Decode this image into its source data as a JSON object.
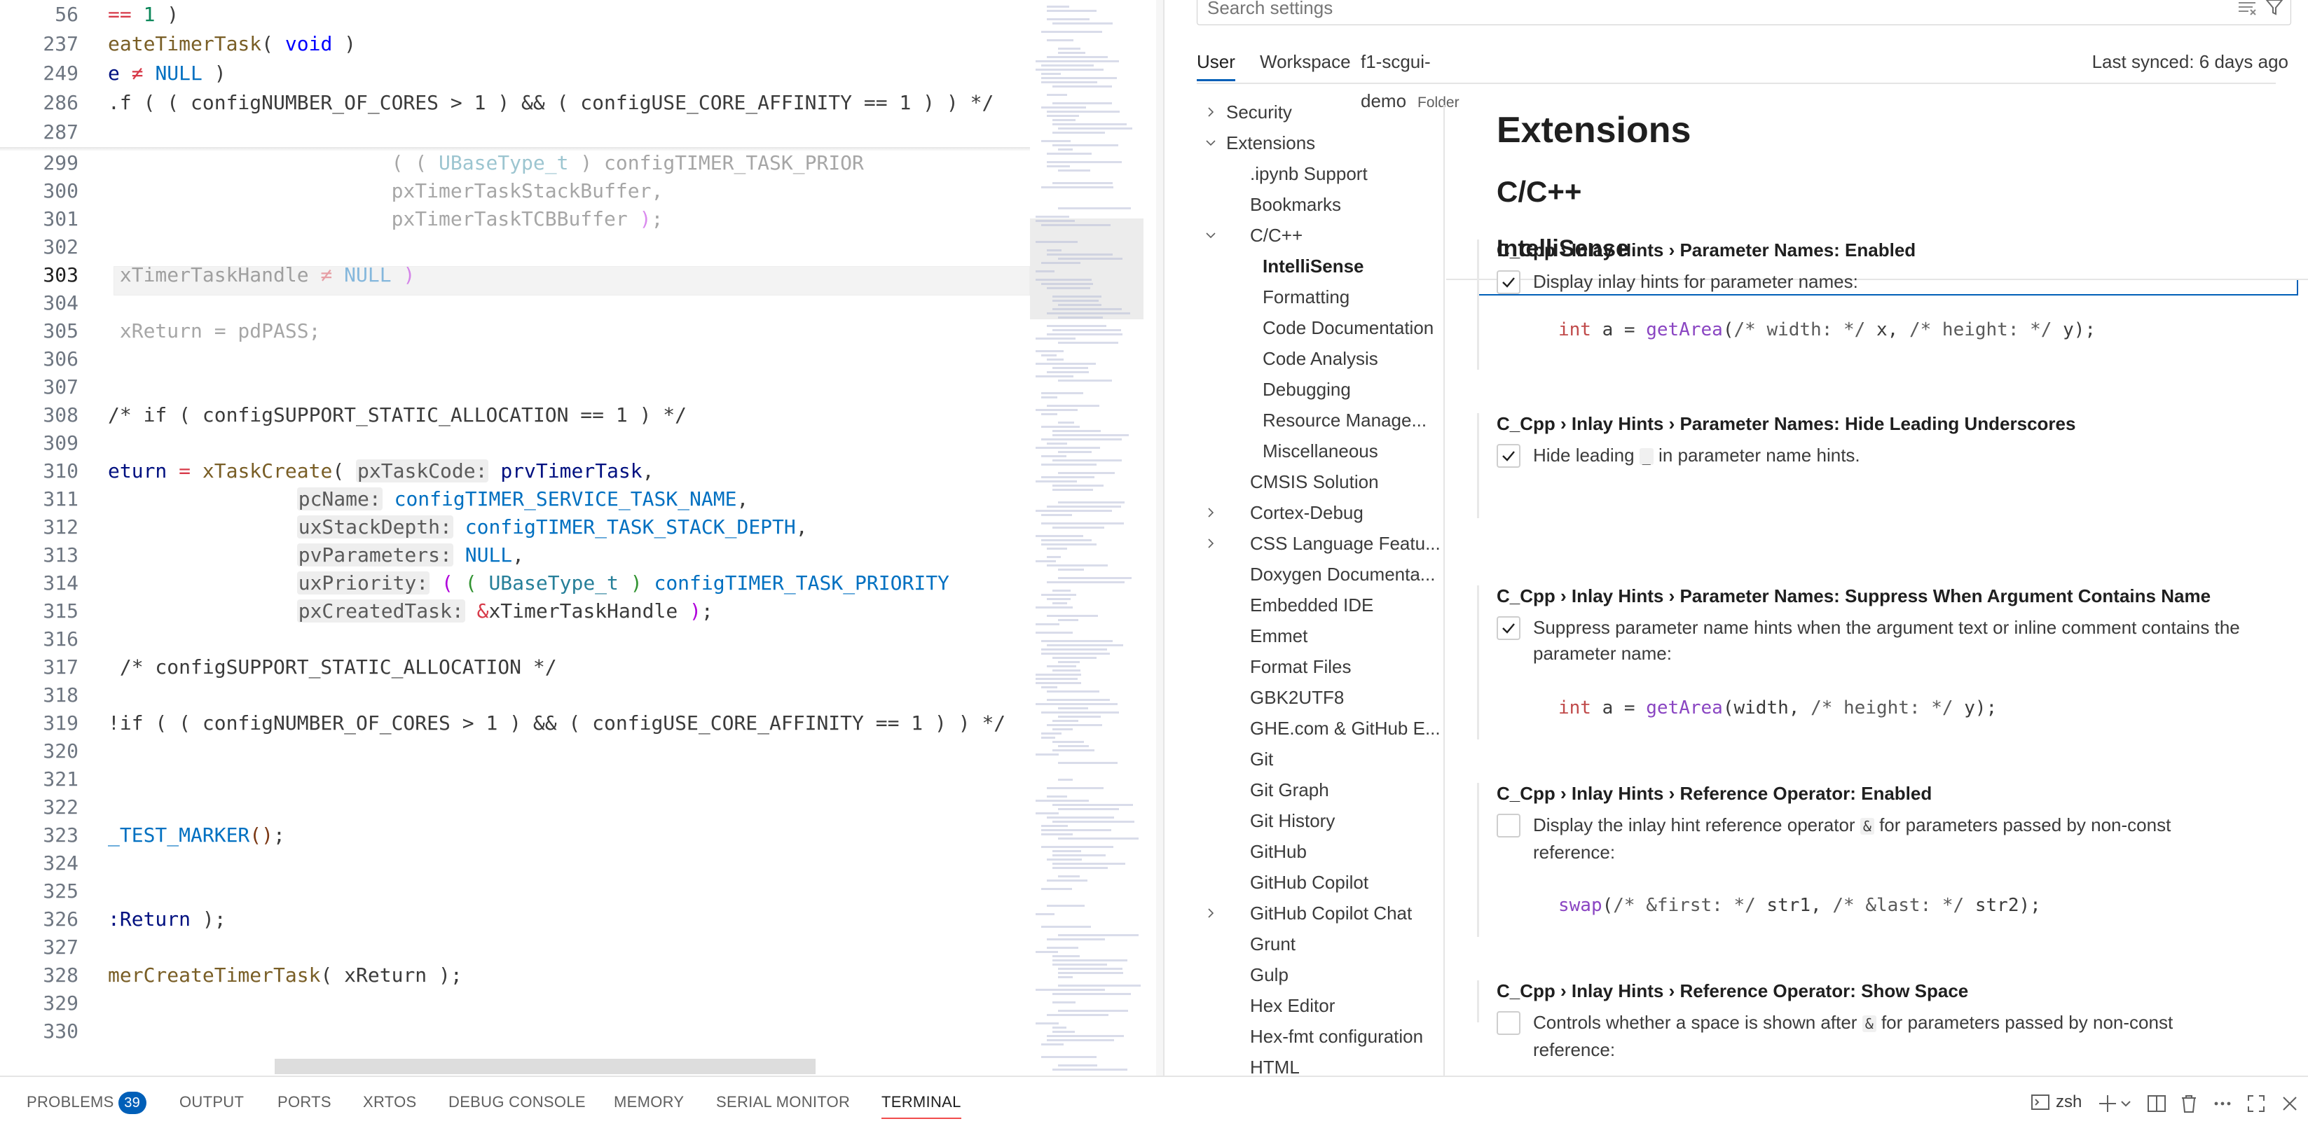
{
  "editor": {
    "lines": [
      {
        "n": "56",
        "sticky": true,
        "html": "<span class='op'>==</span> <span class='nm'>1</span> <span class='br'>)</span>"
      },
      {
        "n": "237",
        "sticky": true,
        "html": "<span class='fn'>eateTimerTask</span>( <span class='k'>void</span> )"
      },
      {
        "n": "249",
        "sticky": true,
        "html": "<span class='vr'>e</span> <span class='op'>&#8800;</span> <span class='mc'>NULL</span> )"
      },
      {
        "n": "286",
        "sticky": true,
        "html": "<span class='cm'>.f ( ( configNUMBER_OF_CORES &gt; 1 ) &amp;&amp; ( configUSE_CORE_AFFINITY &#61;&#61; 1 ) ) */</span>"
      },
      {
        "n": "287",
        "sticky": true,
        "html": ""
      },
      {
        "n": "299",
        "html": "                        <span class='dim'>( ( <span class='ty'>UBaseType_t</span> ) configTIMER_TASK_PRIOR</span>"
      },
      {
        "n": "300",
        "html": "                        <span class='dim'>pxTimerTaskStackBuffer,</span>"
      },
      {
        "n": "301",
        "html": "                        <span class='dim'>pxTimerTaskTCBBuffer <span class='kr'>)</span>;</span>"
      },
      {
        "n": "302",
        "html": ""
      },
      {
        "n": "303",
        "active": true,
        "html": "<span class='dim'> xTimerTaskHandle <span class='op'>&#8800;</span> <span class='mc'>NULL</span> <span class='kr'>)</span></span>"
      },
      {
        "n": "304",
        "html": ""
      },
      {
        "n": "305",
        "html": "<span class='dim'> xReturn = pdPASS;</span>"
      },
      {
        "n": "306",
        "html": ""
      },
      {
        "n": "307",
        "html": ""
      },
      {
        "n": "308",
        "html": "<span class='cm'>/* if ( configSUPPORT_STATIC_ALLOCATION &#61;&#61; 1 ) */</span>"
      },
      {
        "n": "309",
        "html": ""
      },
      {
        "n": "310",
        "html": "<span class='vr'>eturn</span> <span class='op'>=</span> <span class='fn'>xTaskCreate</span>( <span class='hint'>pxTaskCode:</span> <span class='vr'>prvTimerTask</span>,"
      },
      {
        "n": "311",
        "html": "                <span class='hint'>pcName:</span> <span class='mc'>configTIMER_SERVICE_TASK_NAME</span>,"
      },
      {
        "n": "312",
        "html": "                <span class='hint'>uxStackDepth:</span> <span class='mc'>configTIMER_TASK_STACK_DEPTH</span>,"
      },
      {
        "n": "313",
        "html": "                <span class='hint'>pvParameters:</span> <span class='mc'>NULL</span>,"
      },
      {
        "n": "314",
        "html": "                <span class='hint'>uxPriority:</span> <span class='kr'>(</span> <span class='br2'>(</span> <span class='ty'>UBaseType_t</span> <span class='br2'>)</span> <span class='mc'>configTIMER_TASK_PRIORITY</span>"
      },
      {
        "n": "315",
        "html": "                <span class='hint'>pxCreatedTask:</span> <span class='op'>&amp;</span>xTimerTaskHandle <span class='kr'>)</span>;"
      },
      {
        "n": "316",
        "html": ""
      },
      {
        "n": "317",
        "html": " <span class='cm'>/* configSUPPORT_STATIC_ALLOCATION */</span>"
      },
      {
        "n": "318",
        "html": ""
      },
      {
        "n": "319",
        "html": "<span class='cm'>!if ( ( configNUMBER_OF_CORES &gt; 1 ) &amp;&amp; ( configUSE_CORE_AFFINITY &#61;&#61; 1 ) ) */</span>"
      },
      {
        "n": "320",
        "html": ""
      },
      {
        "n": "321",
        "html": ""
      },
      {
        "n": "322",
        "html": ""
      },
      {
        "n": "323",
        "html": "<span class='mc'>_TEST_MARKER</span><span class='br3'>()</span>;"
      },
      {
        "n": "324",
        "html": ""
      },
      {
        "n": "325",
        "html": ""
      },
      {
        "n": "326",
        "html": "<span class='vr'>:Return</span> );"
      },
      {
        "n": "327",
        "html": ""
      },
      {
        "n": "328",
        "html": "<span class='fn'>merCreateTimerTask</span>( xReturn );"
      },
      {
        "n": "329",
        "html": ""
      },
      {
        "n": "330",
        "html": ""
      }
    ]
  },
  "settings": {
    "search_placeholder": "Search settings",
    "tabs": {
      "user": "User",
      "workspace": "Workspace",
      "folder": "f1-scgui-demo",
      "folder_tag": "Folder"
    },
    "last_synced": "Last synced: 6 days ago",
    "toc": [
      {
        "label": "Security",
        "indent": 0,
        "chevron": "right"
      },
      {
        "label": "Extensions",
        "indent": 0,
        "chevron": "down"
      },
      {
        "label": ".ipynb Support",
        "indent": 1
      },
      {
        "label": "Bookmarks",
        "indent": 1
      },
      {
        "label": "C/C++",
        "indent": 1,
        "chevron": "down"
      },
      {
        "label": "IntelliSense",
        "indent": 2,
        "selected": true
      },
      {
        "label": "Formatting",
        "indent": 2
      },
      {
        "label": "Code Documentation",
        "indent": 2
      },
      {
        "label": "Code Analysis",
        "indent": 2
      },
      {
        "label": "Debugging",
        "indent": 2
      },
      {
        "label": "Resource Manage...",
        "indent": 2
      },
      {
        "label": "Miscellaneous",
        "indent": 2
      },
      {
        "label": "CMSIS Solution",
        "indent": 1
      },
      {
        "label": "Cortex-Debug",
        "indent": 1,
        "chevron": "right"
      },
      {
        "label": "CSS Language Featu...",
        "indent": 1,
        "chevron": "right"
      },
      {
        "label": "Doxygen Documenta...",
        "indent": 1
      },
      {
        "label": "Embedded IDE",
        "indent": 1
      },
      {
        "label": "Emmet",
        "indent": 1
      },
      {
        "label": "Format Files",
        "indent": 1
      },
      {
        "label": "GBK2UTF8",
        "indent": 1
      },
      {
        "label": "GHE.com & GitHub E...",
        "indent": 1
      },
      {
        "label": "Git",
        "indent": 1
      },
      {
        "label": "Git Graph",
        "indent": 1
      },
      {
        "label": "Git History",
        "indent": 1
      },
      {
        "label": "GitHub",
        "indent": 1
      },
      {
        "label": "GitHub Copilot",
        "indent": 1
      },
      {
        "label": "GitHub Copilot Chat",
        "indent": 1,
        "chevron": "right"
      },
      {
        "label": "Grunt",
        "indent": 1
      },
      {
        "label": "Gulp",
        "indent": 1
      },
      {
        "label": "Hex Editor",
        "indent": 1
      },
      {
        "label": "Hex-fmt configuration",
        "indent": 1
      },
      {
        "label": "HTML",
        "indent": 1
      }
    ],
    "headings": {
      "extensions": "Extensions",
      "cpp": "C/C++",
      "intellisense": "IntelliSense"
    },
    "items": [
      {
        "title_cat": "C_Cpp › Inlay Hints › ",
        "title_name": "Parameter Names: Enabled",
        "checked": true,
        "desc_pre": "Display inlay hints for parameter names:",
        "code": "",
        "desc_post": "",
        "example": "int a = getArea(/* width: */ x, /* height: */ y);"
      },
      {
        "title_cat": "C_Cpp › Inlay Hints › ",
        "title_name": "Parameter Names: Hide Leading Underscores",
        "checked": true,
        "desc_pre": "Hide leading ",
        "code": "_",
        "desc_post": " in parameter name hints.",
        "example": ""
      },
      {
        "title_cat": "C_Cpp › Inlay Hints › ",
        "title_name": "Parameter Names: Suppress When Argument Contains Name",
        "checked": true,
        "desc_pre": "Suppress parameter name hints when the argument text or inline comment contains the parameter name:",
        "code": "",
        "desc_post": "",
        "example": "int a = getArea(width, /* height: */ y);"
      },
      {
        "title_cat": "C_Cpp › Inlay Hints › ",
        "title_name": "Reference Operator: Enabled",
        "checked": false,
        "desc_pre": "Display the inlay hint reference operator ",
        "code": "&",
        "desc_post": " for parameters passed by non-const reference:",
        "example": "swap(/* &first: */ str1, /* &last: */ str2);"
      },
      {
        "title_cat": "C_Cpp › Inlay Hints › ",
        "title_name": "Reference Operator: Show Space",
        "checked": false,
        "desc_pre": "Controls whether a space is shown after ",
        "code": "&",
        "desc_post": " for parameters passed by non-const reference:",
        "example": ""
      }
    ]
  },
  "panel": {
    "tabs": [
      {
        "label": "PROBLEMS",
        "badge": "39"
      },
      {
        "label": "OUTPUT"
      },
      {
        "label": "PORTS"
      },
      {
        "label": "XRTOS"
      },
      {
        "label": "DEBUG CONSOLE"
      },
      {
        "label": "MEMORY"
      },
      {
        "label": "SERIAL MONITOR"
      },
      {
        "label": "TERMINAL",
        "active": true
      }
    ],
    "shell": "zsh"
  },
  "icons": {
    "clear_filter": "clear-filter-icon",
    "filter": "filter-icon",
    "terminal": "terminal-icon",
    "add": "plus-icon",
    "split": "split-icon",
    "trash": "trash-icon",
    "more": "more-icon",
    "maximize": "maximize-icon",
    "close": "close-icon"
  },
  "colors": {
    "accent": "#005fb8",
    "badge": "#005fb8",
    "active_tab_underline": "#f14c4c"
  }
}
